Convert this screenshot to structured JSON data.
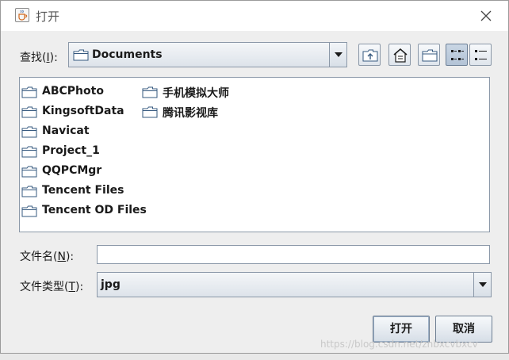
{
  "window": {
    "title": "打开",
    "close_symbol": "×"
  },
  "look_in": {
    "label": "查找(",
    "mnemonic": "I",
    "suffix": "):",
    "value": "Documents",
    "icon": "folder-icon"
  },
  "toolbar": {
    "buttons": [
      {
        "name": "up-one-level",
        "icon": "folder-up-icon"
      },
      {
        "name": "home",
        "icon": "home-icon"
      },
      {
        "name": "new-folder",
        "icon": "new-folder-icon"
      },
      {
        "name": "list-view",
        "icon": "list-view-icon",
        "selected": true
      },
      {
        "name": "details-view",
        "icon": "details-view-icon",
        "selected": false
      }
    ]
  },
  "files": {
    "column1": [
      "ABCPhoto",
      "KingsoftData",
      "Navicat",
      "Project_1",
      "QQPCMgr",
      "Tencent Files",
      "Tencent OD Files"
    ],
    "column2": [
      "手机模拟大师",
      "腾讯影视库"
    ]
  },
  "file_name": {
    "label": "文件名(",
    "mnemonic": "N",
    "suffix": "):",
    "value": ""
  },
  "file_type": {
    "label": "文件类型(",
    "mnemonic": "T",
    "suffix": "):",
    "value": "jpg"
  },
  "buttons": {
    "open": "打开",
    "cancel": "取消"
  },
  "watermark": "https://blog.csdn.net/znbxcvbxcv",
  "colors": {
    "dialog_bg": "#eeeeee",
    "border": "#8b98a8",
    "folder_fill": "#ffffff",
    "folder_stroke": "#36597f"
  }
}
